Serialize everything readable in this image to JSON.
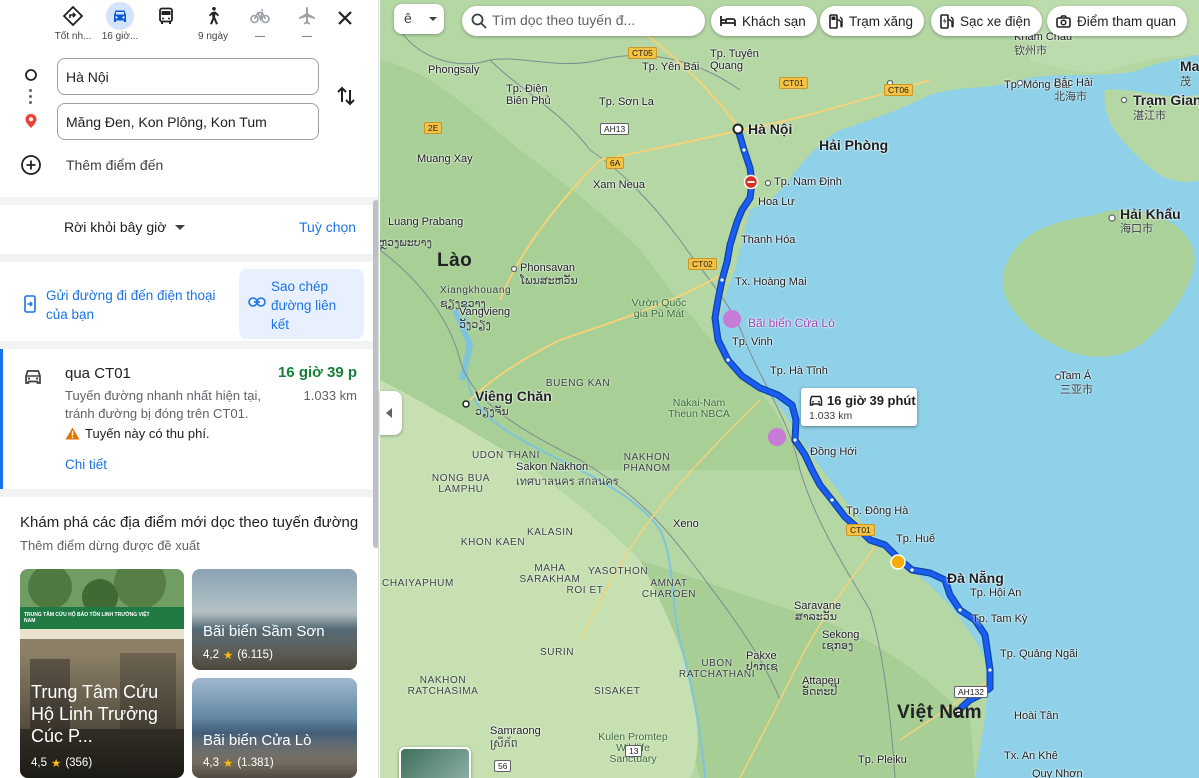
{
  "modes": [
    {
      "name": "best",
      "label": "Tốt nh..."
    },
    {
      "name": "driving",
      "label": "16 giờ..."
    },
    {
      "name": "transit",
      "label": ""
    },
    {
      "name": "walking",
      "label": "9 ngày"
    },
    {
      "name": "cycling",
      "label": "—"
    },
    {
      "name": "flight",
      "label": "—"
    }
  ],
  "origin": "Hà Nội",
  "destination": "Măng Đen, Kon Plông, Kon Tum",
  "add_destination": "Thêm điểm đến",
  "leave_now": "Rời khỏi bây giờ",
  "options": "Tuỳ chọn",
  "send_to_phone": "Gửi đường đi đến điện thoại của bạn",
  "copy_link": "Sao chép đường liên kết",
  "route": {
    "name": "qua CT01",
    "time": "16 giờ 39 p",
    "desc": "Tuyến đường nhanh nhất hiện tại, tránh đường bị đóng trên CT01.",
    "distance": "1.033 km",
    "warning": "Tuyến này có thu phí.",
    "details": "Chi tiết"
  },
  "explore": {
    "title": "Khám phá các địa điểm mới dọc theo tuyến đường",
    "subtitle": "Thêm điểm dừng được đề xuất",
    "places": [
      {
        "name": "Trung Tâm Cứu Hộ Linh Trưởng Cúc P...",
        "rating": "4,5",
        "count": "(356)",
        "sign": "TRUNG TÂM CỨU HỘ BẢO TỒN LINH TRƯỞNG VIỆT NAM"
      },
      {
        "name": "Bãi biển Sầm Sơn",
        "rating": "4,2",
        "count": "(6.115)"
      },
      {
        "name": "Bãi biển Cửa Lò",
        "rating": "4,3",
        "count": "(1.381)"
      }
    ]
  },
  "map": {
    "layer_glyph": "ê",
    "search_placeholder": "Tìm dọc theo tuyến đ...",
    "chips": [
      "Khách sạn",
      "Trạm xăng",
      "Sạc xe điện",
      "Điểm tham quan"
    ],
    "duration_label": "16 giờ 39 phút",
    "distance_label": "1.033 km",
    "labels": [
      {
        "text": "Phongsaly",
        "kind": "city"
      },
      {
        "text": "Lào",
        "kind": "country"
      },
      {
        "text": "Việt Nam",
        "kind": "country"
      },
      {
        "text": "Hà Nội",
        "kind": "major"
      },
      {
        "text": "Hải Phòng",
        "kind": "major"
      },
      {
        "text": "Tp. Nam Định",
        "kind": "city"
      },
      {
        "text": "Hoa Lư",
        "kind": "city"
      },
      {
        "text": "Thanh Hóa",
        "kind": "city"
      },
      {
        "text": "Tx. Hoàng Mai",
        "kind": "city"
      },
      {
        "text": "Bãi biển Cửa Lò",
        "kind": "poi"
      },
      {
        "text": "Tp. Vinh",
        "kind": "city"
      },
      {
        "text": "Tp. Hà Tĩnh",
        "kind": "city"
      },
      {
        "text": "Đồng Hới",
        "kind": "city"
      },
      {
        "text": "Tp. Đông Hà",
        "kind": "city"
      },
      {
        "text": "Tp. Huế",
        "kind": "city"
      },
      {
        "text": "Đà Nẵng",
        "kind": "major"
      },
      {
        "text": "Tp. Hội An",
        "kind": "city"
      },
      {
        "text": "Tp. Tam Kỳ",
        "kind": "city"
      },
      {
        "text": "Tp. Quảng Ngãi",
        "kind": "city"
      },
      {
        "text": "Hoài Tân",
        "kind": "city"
      },
      {
        "text": "Tx. An Khê",
        "kind": "city"
      },
      {
        "text": "Tp. Pleiku",
        "kind": "city"
      },
      {
        "text": "Quy Nhơn",
        "kind": "city"
      },
      {
        "text": "Tp. Tuyên Quang",
        "kind": "city"
      },
      {
        "text": "Tp. Yên Bái",
        "kind": "city"
      },
      {
        "text": "Tp. Điện Biên Phủ",
        "kind": "city"
      },
      {
        "text": "Tp. Sơn La",
        "kind": "city"
      },
      {
        "text": "Muang Xay",
        "kind": "city"
      },
      {
        "text": "Xam Neua",
        "kind": "city"
      },
      {
        "text": "Luang Prabang",
        "kind": "city"
      },
      {
        "text": "ຫຼວງພະບາງ",
        "kind": "script"
      },
      {
        "text": "Phonsavan",
        "kind": "city"
      },
      {
        "text": "ໂພນສະຫວັນ",
        "kind": "script"
      },
      {
        "text": "Xiangkhouang",
        "kind": "region"
      },
      {
        "text": "ຊຽງຂວາງ",
        "kind": "script"
      },
      {
        "text": "Vangvieng",
        "kind": "city"
      },
      {
        "text": "ວັງວຽງ",
        "kind": "script"
      },
      {
        "text": "Vườn Quốc gia Pù Mát",
        "kind": "park"
      },
      {
        "text": "Viêng Chăn",
        "kind": "major"
      },
      {
        "text": "ວຽງຈັນ",
        "kind": "script"
      },
      {
        "text": "BUENG KAN",
        "kind": "region"
      },
      {
        "text": "Nakai-Nam Theun NBCA",
        "kind": "park"
      },
      {
        "text": "UDON THANI",
        "kind": "region"
      },
      {
        "text": "Sakon Nakhon",
        "kind": "city"
      },
      {
        "text": "เทศบาลนคร สกลนคร",
        "kind": "script"
      },
      {
        "text": "NAKHON PHANOM",
        "kind": "region"
      },
      {
        "text": "NONG BUA LAMPHU",
        "kind": "region"
      },
      {
        "text": "KHON KAEN",
        "kind": "region"
      },
      {
        "text": "KALASIN",
        "kind": "region"
      },
      {
        "text": "MAHA SARAKHAM",
        "kind": "region"
      },
      {
        "text": "YASOTHON",
        "kind": "region"
      },
      {
        "text": "AMNAT CHAROEN",
        "kind": "region"
      },
      {
        "text": "ROI ET",
        "kind": "region"
      },
      {
        "text": "SURIN",
        "kind": "region"
      },
      {
        "text": "UBON RATCHATHANI",
        "kind": "region"
      },
      {
        "text": "SISAKET",
        "kind": "region"
      },
      {
        "text": "NAKHON RATCHASIMA",
        "kind": "region"
      },
      {
        "text": "CHAIYAPHUM",
        "kind": "region"
      },
      {
        "text": "Xeno",
        "kind": "city"
      },
      {
        "text": "Saravane",
        "kind": "city"
      },
      {
        "text": "ສາລະວັນ",
        "kind": "script"
      },
      {
        "text": "Sekong",
        "kind": "city"
      },
      {
        "text": "ເຊກອງ",
        "kind": "script"
      },
      {
        "text": "Pakxe",
        "kind": "city"
      },
      {
        "text": "ປາກເຊ",
        "kind": "script"
      },
      {
        "text": "Attapeu",
        "kind": "city"
      },
      {
        "text": "ອັດຕະປື",
        "kind": "script"
      },
      {
        "text": "Samraong",
        "kind": "city"
      },
      {
        "text": "ស្រីភ័ព",
        "kind": "script"
      },
      {
        "text": "Kulen Promtep Wildlife Sanctuary",
        "kind": "park"
      },
      {
        "text": "Tp. Móng Cái",
        "kind": "city"
      },
      {
        "text": "Bắc Hải",
        "kind": "city"
      },
      {
        "text": "北海市",
        "kind": "script"
      },
      {
        "text": "Trạm Giang",
        "kind": "major"
      },
      {
        "text": "湛江市",
        "kind": "script"
      },
      {
        "text": "Hải Khẩu",
        "kind": "major"
      },
      {
        "text": "海口市",
        "kind": "script"
      },
      {
        "text": "Tam Á",
        "kind": "city"
      },
      {
        "text": "三亚市",
        "kind": "script"
      },
      {
        "text": "Khâm Châu",
        "kind": "city"
      },
      {
        "text": "钦州市",
        "kind": "script"
      },
      {
        "text": "Ma",
        "kind": "major"
      },
      {
        "text": "茂",
        "kind": "script"
      }
    ],
    "road_shields": [
      "CT05",
      "CT01",
      "CT06",
      "2E",
      "AH13",
      "6A",
      "CT02",
      "CT01",
      "AH132",
      "56",
      "13"
    ]
  },
  "colors": {
    "route": "#1a5cf5",
    "link": "#1a73e8",
    "time_green": "#188038",
    "land": "#b4d7a4",
    "sea": "#8fd1e8"
  }
}
